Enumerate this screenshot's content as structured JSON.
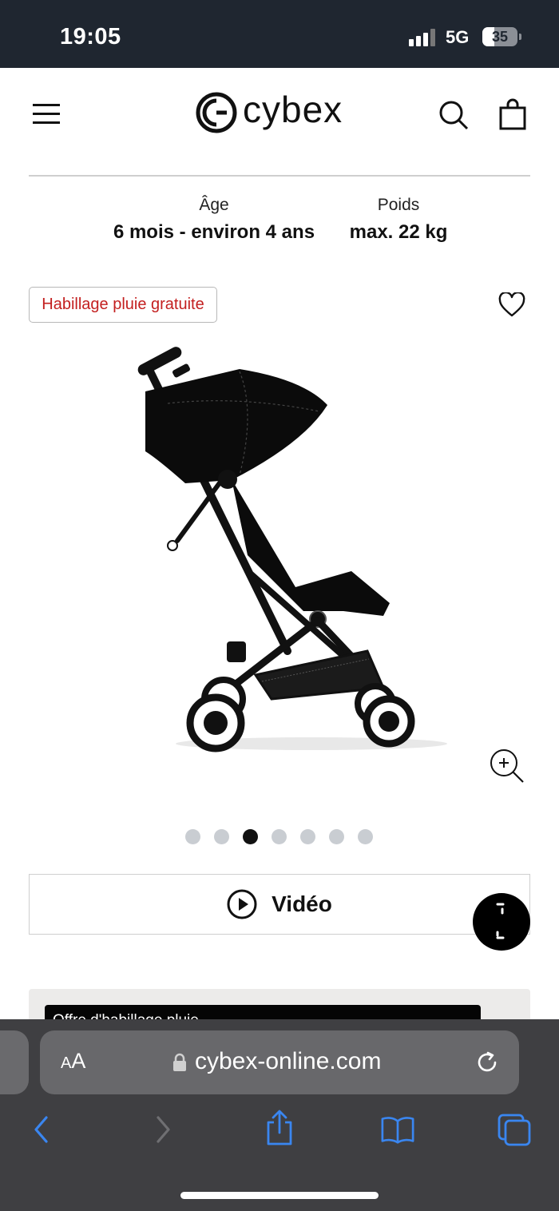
{
  "status_bar": {
    "time": "19:05",
    "network": "5G",
    "battery_level": "35"
  },
  "header": {
    "brand": "cybex",
    "icons": [
      "menu-icon",
      "search-icon",
      "shopping-bag-icon"
    ]
  },
  "specs": {
    "age_label": "Âge",
    "age_value": "6 mois - environ 4 ans",
    "weight_label": "Poids",
    "weight_value": "max. 22 kg"
  },
  "product": {
    "promo_badge": "Habillage pluie gratuite",
    "image_icon": "stroller-image",
    "gallery": {
      "total": 7,
      "active_index": 2
    },
    "video_label": "Vidéo"
  },
  "promo_card": {
    "text": "Offre d'habillage pluie"
  },
  "browser": {
    "text_size_label_small": "A",
    "text_size_label_large": "A",
    "url": "cybex-online.com"
  },
  "colors": {
    "status_bar_bg": "#1f2630",
    "promo_text": "#c31f1f",
    "browser_bg": "#3f3f42",
    "browser_icon_blue": "#3a86f0",
    "gallery_dot_active": "#111111",
    "gallery_dot_inactive": "#c9cdd2"
  }
}
